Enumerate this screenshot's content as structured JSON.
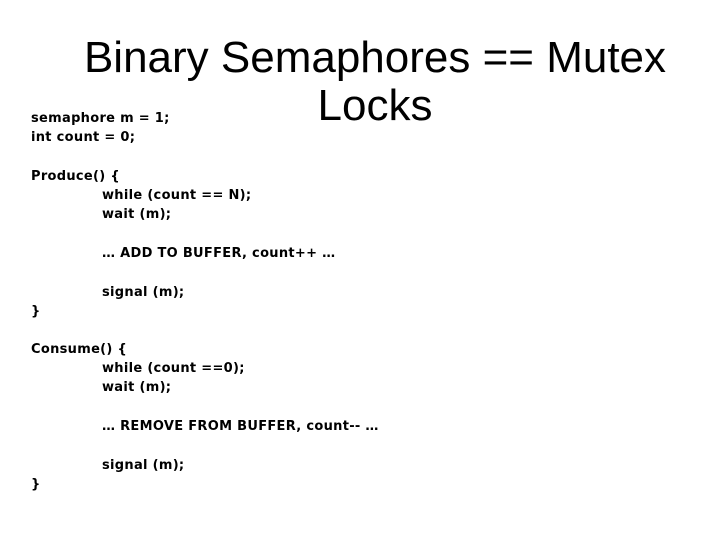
{
  "slide": {
    "title": "Binary Semaphores == Mutex Locks",
    "declarations": [
      "semaphore m = 1;",
      "int count = 0;"
    ],
    "produce": {
      "header": "Produce() {",
      "lines": [
        "while (count == N);",
        "wait (m);",
        "… ADD TO BUFFER, count++ …",
        "signal (m);"
      ],
      "close": "}"
    },
    "consume": {
      "header": "Consume() {",
      "lines": [
        "while (count ==0);",
        "wait (m);",
        "… REMOVE FROM BUFFER, count-- …",
        "signal (m);"
      ],
      "close": "}"
    }
  }
}
